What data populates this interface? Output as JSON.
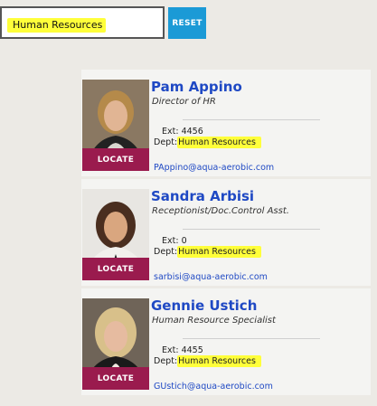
{
  "search": {
    "value": "Human Resources"
  },
  "reset_label": "RESET",
  "colors": {
    "accent": "#1b9ad6",
    "locate": "#9a1b4e",
    "highlight": "#ffff3a",
    "link": "#1f49c4"
  },
  "employees": [
    {
      "name": "Pam Appino",
      "title": "Director of HR",
      "ext_label": "Ext:",
      "ext": "4456",
      "dept_label": "Dept:",
      "dept": "Human Resources",
      "email": "PAppino@aqua-aerobic.com",
      "locate_label": "LOCATE"
    },
    {
      "name": "Sandra Arbisi",
      "title": "Receptionist/Doc.Control Asst.",
      "ext_label": "Ext:",
      "ext": "0",
      "dept_label": "Dept:",
      "dept": "Human Resources",
      "email": "sarbisi@aqua-aerobic.com",
      "locate_label": "LOCATE"
    },
    {
      "name": "Gennie Ustich",
      "title": "Human Resource Specialist",
      "ext_label": "Ext:",
      "ext": "4455",
      "dept_label": "Dept:",
      "dept": "Human Resources",
      "email": "GUstich@aqua-aerobic.com",
      "locate_label": "LOCATE"
    }
  ]
}
